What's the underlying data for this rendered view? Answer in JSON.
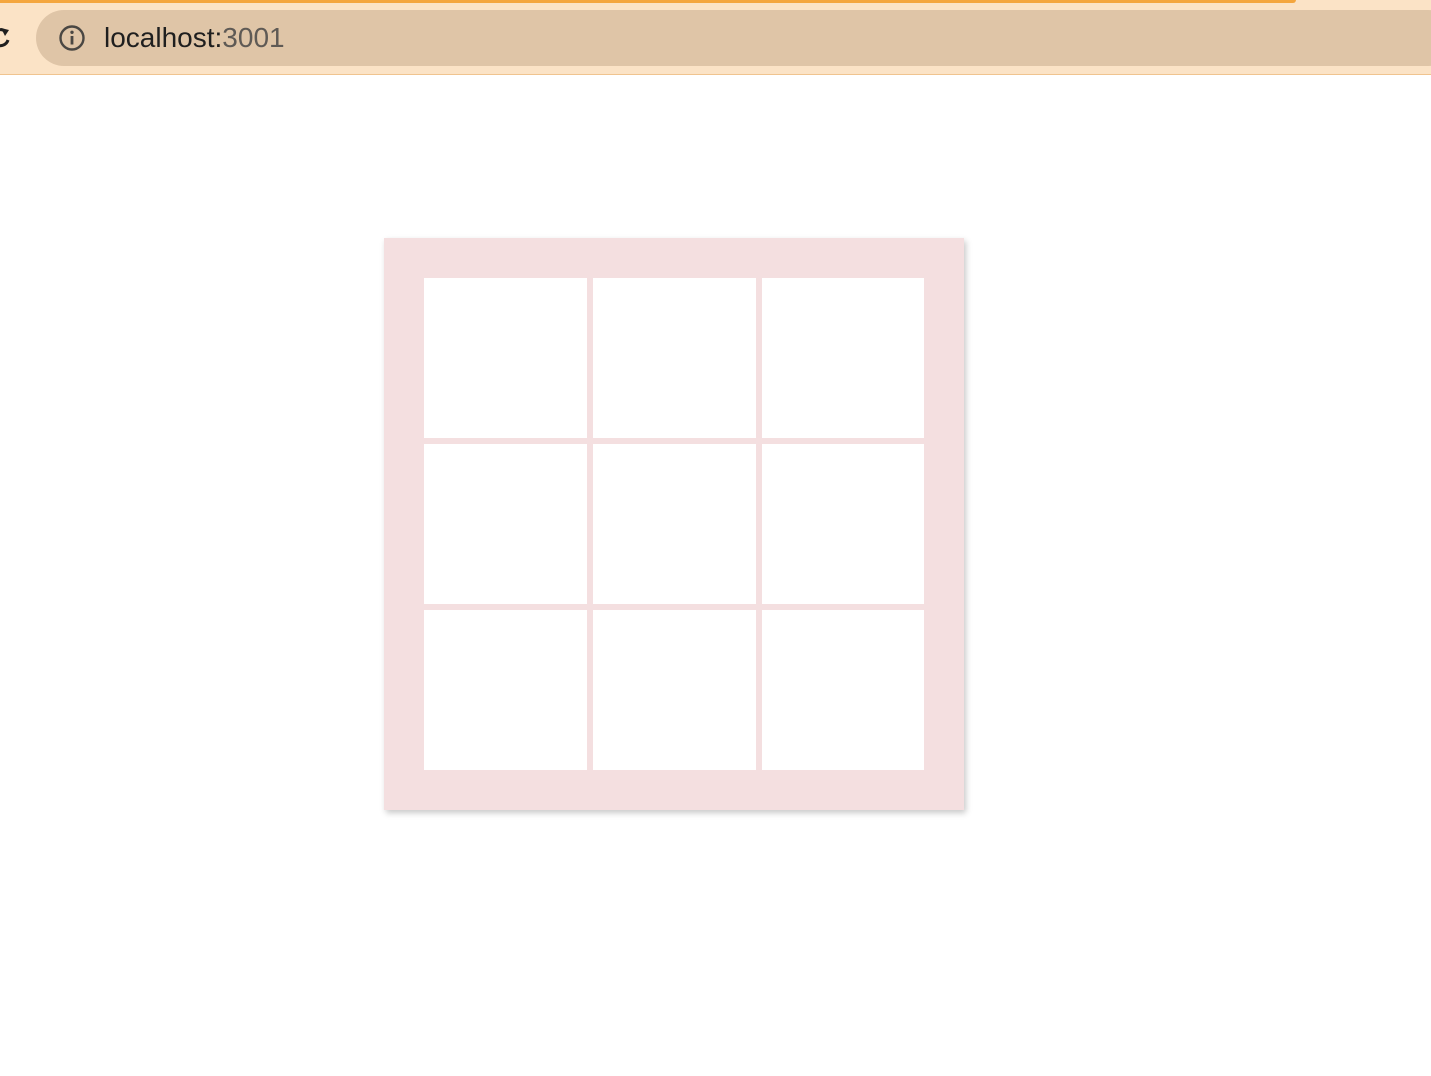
{
  "browser": {
    "url_host": "localhost:",
    "url_port": "3001",
    "icons": [
      "reload-icon",
      "info-icon"
    ],
    "accent_color": "#f4a63e",
    "toolbar_color": "#fbe3c6"
  },
  "board": {
    "rows": 3,
    "columns": 3,
    "cells": [
      "",
      "",
      "",
      "",
      "",
      "",
      "",
      "",
      ""
    ],
    "frame_color": "#f4dfe0",
    "cell_color": "#ffffff"
  }
}
